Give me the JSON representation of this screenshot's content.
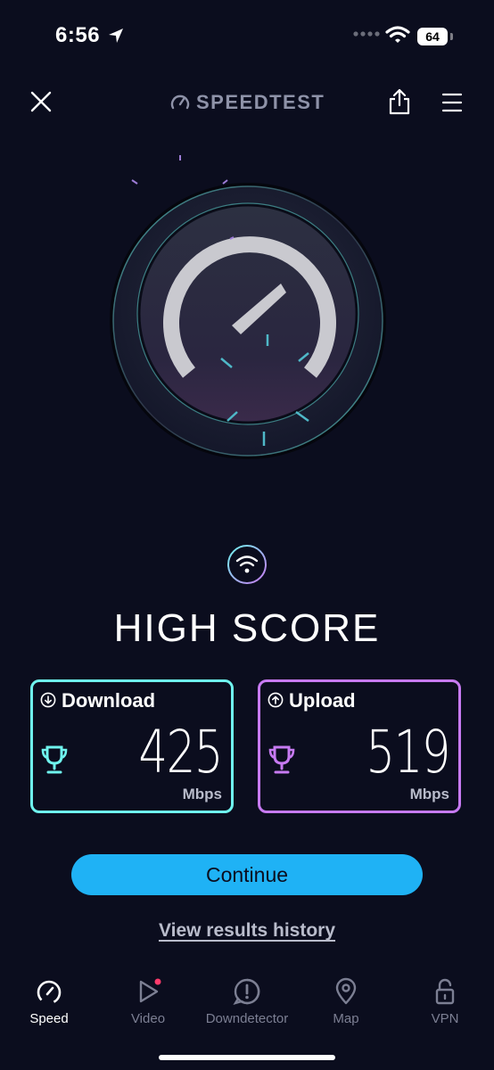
{
  "status_bar": {
    "time": "6:56",
    "battery": "64"
  },
  "header": {
    "brand": "SPEEDTEST"
  },
  "result": {
    "score_label": "HIGH SCORE"
  },
  "download": {
    "label": "Download",
    "value": "425",
    "unit": "Mbps"
  },
  "upload": {
    "label": "Upload",
    "value": "519",
    "unit": "Mbps"
  },
  "actions": {
    "continue_label": "Continue",
    "history_label": "View results history"
  },
  "tabs": [
    {
      "label": "Speed",
      "icon": "speedometer-icon",
      "active": true
    },
    {
      "label": "Video",
      "icon": "play-icon",
      "active": false
    },
    {
      "label": "Downdetector",
      "icon": "alert-icon",
      "active": false
    },
    {
      "label": "Map",
      "icon": "map-pin-icon",
      "active": false
    },
    {
      "label": "VPN",
      "icon": "lock-icon",
      "active": false
    }
  ],
  "colors": {
    "background": "#0b0d1e",
    "download_accent": "#6ff3ee",
    "upload_accent": "#c77af2",
    "continue_button": "#1fb2f5",
    "video_badge": "#ff3b6b"
  }
}
